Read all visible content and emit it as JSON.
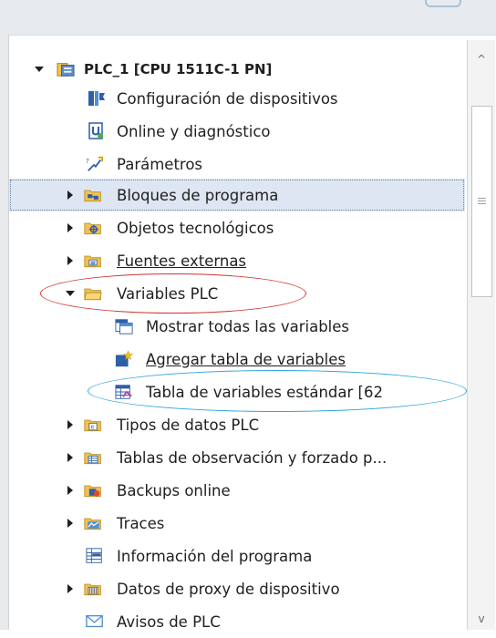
{
  "tree": {
    "root_label": "PLC_1 [CPU 1511C-1 PN]",
    "items": [
      {
        "label": "Configuración de dispositivos",
        "icon": "device-config-icon"
      },
      {
        "label": "Online y diagnóstico",
        "icon": "online-diagnostics-icon"
      },
      {
        "label": "Parámetros",
        "icon": "parameters-icon"
      },
      {
        "label": "Bloques de programa",
        "icon": "program-blocks-folder-icon"
      },
      {
        "label": "Objetos tecnológicos",
        "icon": "technology-objects-folder-icon"
      },
      {
        "label": "Fuentes externas",
        "icon": "external-sources-folder-icon"
      },
      {
        "label": "Variables PLC",
        "icon": "plc-tags-folder-icon"
      },
      {
        "label": "Mostrar todas las variables",
        "icon": "show-all-tags-icon"
      },
      {
        "label": "Agregar tabla de variables",
        "icon": "add-tag-table-icon"
      },
      {
        "label": "Tabla de variables estándar [62",
        "icon": "tag-table-icon"
      },
      {
        "label": "Tipos de datos PLC",
        "icon": "plc-data-types-folder-icon"
      },
      {
        "label": "Tablas de observación y forzado p...",
        "icon": "watch-force-tables-folder-icon"
      },
      {
        "label": "Backups online",
        "icon": "online-backups-folder-icon"
      },
      {
        "label": "Traces",
        "icon": "traces-folder-icon"
      },
      {
        "label": "Información del programa",
        "icon": "program-info-icon"
      },
      {
        "label": "Datos de proxy de dispositivo",
        "icon": "device-proxy-data-folder-icon"
      },
      {
        "label": "Avisos de PLC",
        "icon": "plc-alarms-icon"
      }
    ]
  },
  "colors": {
    "selection": "#dde6f2",
    "red_annotation": "#d0342c",
    "blue_annotation": "#2fa6d6",
    "folder": "#f2c14e"
  },
  "scrollbar": {
    "up": "^",
    "down": "v"
  }
}
